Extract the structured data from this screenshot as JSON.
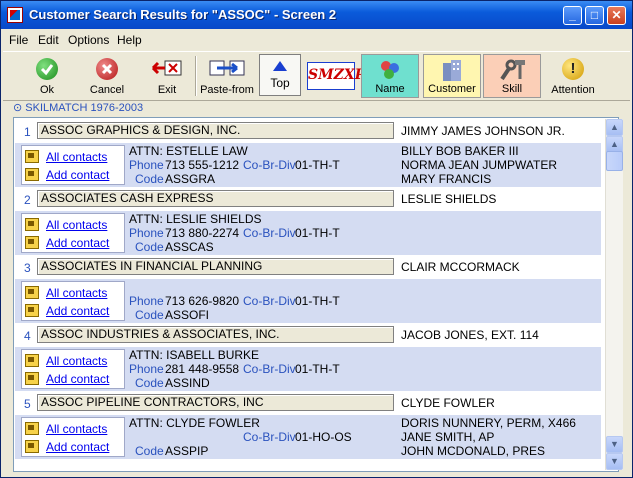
{
  "window": {
    "title": "Customer Search Results for \"ASSOC\" - Screen 2"
  },
  "menu": {
    "items": [
      "File",
      "Edit",
      "Options",
      "Help"
    ]
  },
  "toolbar": {
    "ok": "Ok",
    "cancel": "Cancel",
    "exit": "Exit",
    "paste_from": "Paste-from",
    "top": "Top",
    "smz_logo": "SMZXP",
    "name": "Name",
    "customer": "Customer",
    "skill": "Skill",
    "attention": "Attention"
  },
  "status": {
    "text": "SKILMATCH 1976-2003"
  },
  "labels": {
    "all_contacts": "All contacts",
    "add_contact": "Add contact",
    "phone": "Phone",
    "code": "Code",
    "cobrdiv": "Co-Br-Div"
  },
  "records": [
    {
      "num": "1",
      "name": "ASSOC GRAPHICS & DESIGN, INC.",
      "contacts": [
        "JIMMY JAMES JOHNSON JR.",
        "BILLY BOB BAKER III",
        "NORMA JEAN JUMPWATER",
        "MARY FRANCIS"
      ],
      "attn": "ATTN: ESTELLE LAW",
      "phone": "713 555-1212",
      "cobrdiv": "01-TH-T",
      "code": "ASSGRA"
    },
    {
      "num": "2",
      "name": "ASSOCIATES CASH EXPRESS",
      "contacts": [
        "LESLIE SHIELDS"
      ],
      "attn": "ATTN: LESLIE SHIELDS",
      "phone": "713 880-2274",
      "cobrdiv": "01-TH-T",
      "code": "ASSCAS"
    },
    {
      "num": "3",
      "name": "ASSOCIATES IN FINANCIAL PLANNING",
      "contacts": [
        "CLAIR MCCORMACK"
      ],
      "attn": "",
      "phone": "713 626-9820",
      "cobrdiv": "01-TH-T",
      "code": "ASSOFI"
    },
    {
      "num": "4",
      "name": "ASSOC INDUSTRIES & ASSOCIATES, INC.",
      "contacts": [
        "JACOB JONES, EXT. 114"
      ],
      "attn": "ATTN: ISABELL BURKE",
      "phone": "281 448-9558",
      "cobrdiv": "01-TH-T",
      "code": "ASSIND"
    },
    {
      "num": "5",
      "name": "ASSOC PIPELINE CONTRACTORS, INC",
      "contacts": [
        "CLYDE FOWLER",
        "DORIS NUNNERY, PERM, X466",
        "JANE SMITH, AP",
        "JOHN MCDONALD, PRES"
      ],
      "attn": "ATTN: CLYDE FOWLER",
      "phone": "",
      "cobrdiv": "01-HO-OS",
      "code": "ASSPIP"
    }
  ]
}
